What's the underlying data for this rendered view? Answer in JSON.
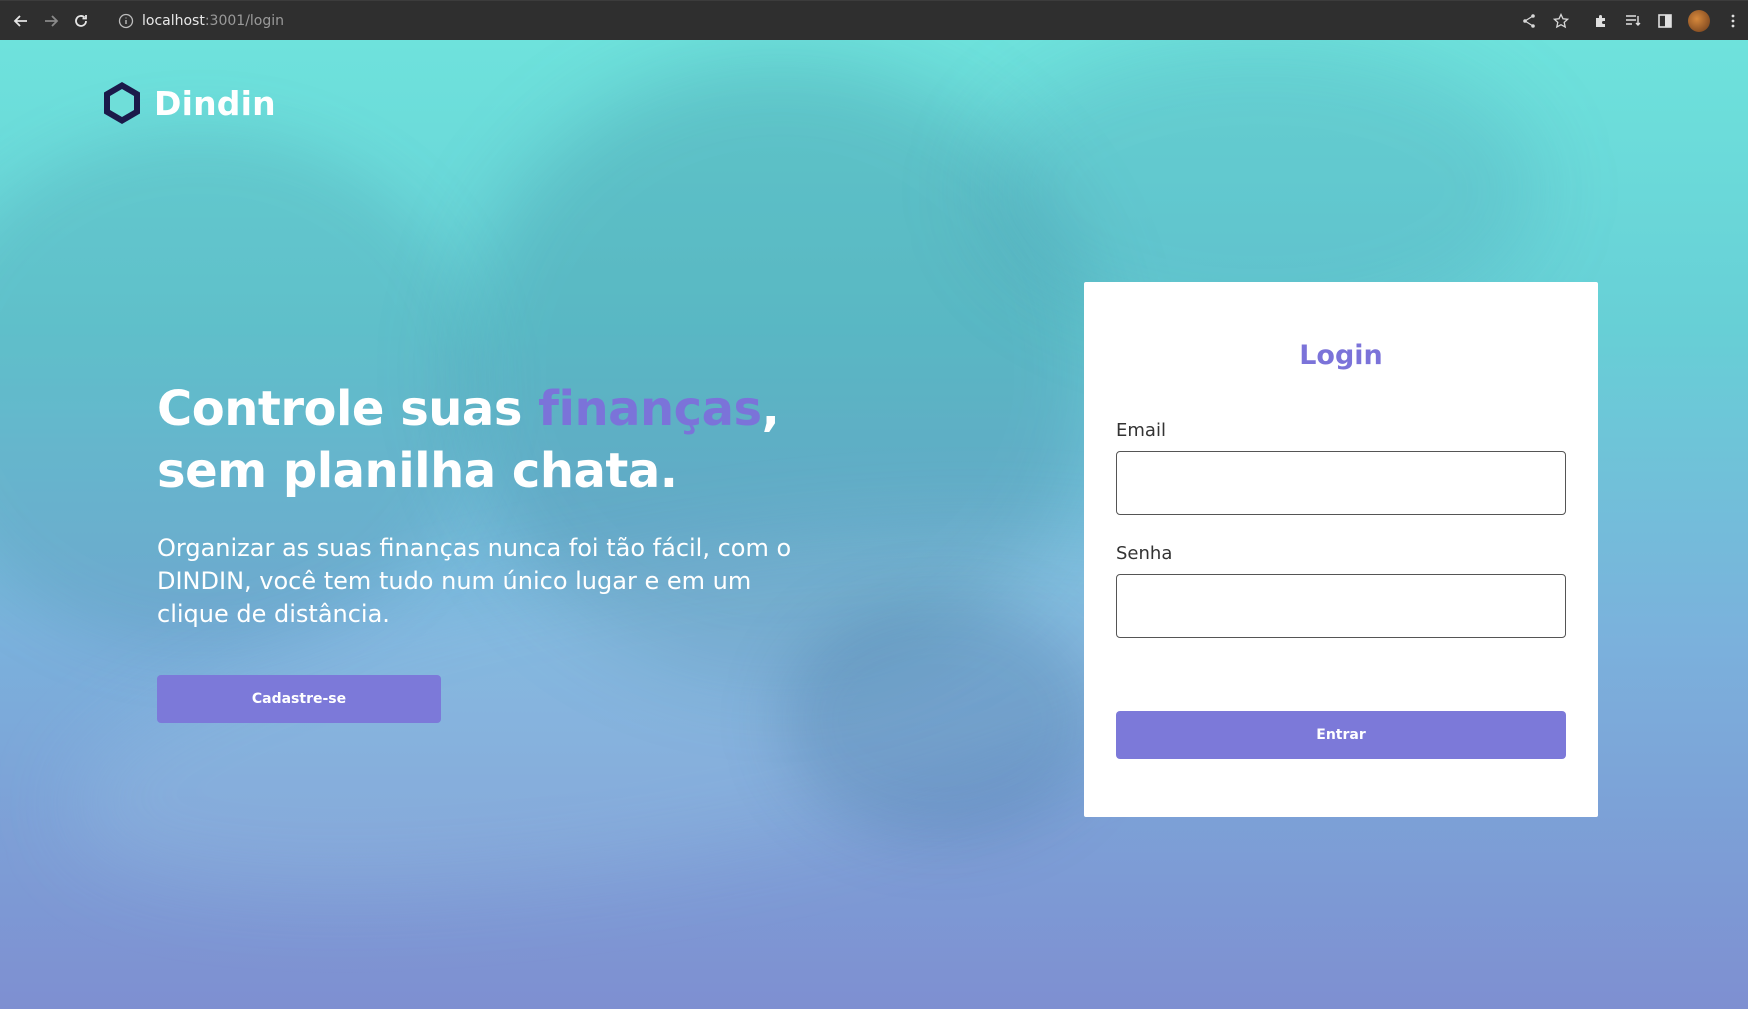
{
  "browser": {
    "url_host": "localhost",
    "url_rest": ":3001/login"
  },
  "logo": {
    "text": "Dindin"
  },
  "hero": {
    "title_part1": "Controle suas ",
    "title_accent": "finanças",
    "title_part2": ",",
    "title_line2": "sem planilha chata.",
    "subtitle": "Organizar as suas finanças nunca foi tão fácil, com o DINDIN, você tem tudo num único lugar e em um clique de distância."
  },
  "signup_button": {
    "label": "Cadastre-se"
  },
  "login_card": {
    "title": "Login",
    "email_label": "Email",
    "email_value": "",
    "password_label": "Senha",
    "password_value": "",
    "submit_label": "Entrar"
  },
  "colors": {
    "accent": "#7b73d9",
    "button": "#7c79d9",
    "gradient_top": "#6ee2dc",
    "gradient_bottom": "#7e8fd1"
  }
}
